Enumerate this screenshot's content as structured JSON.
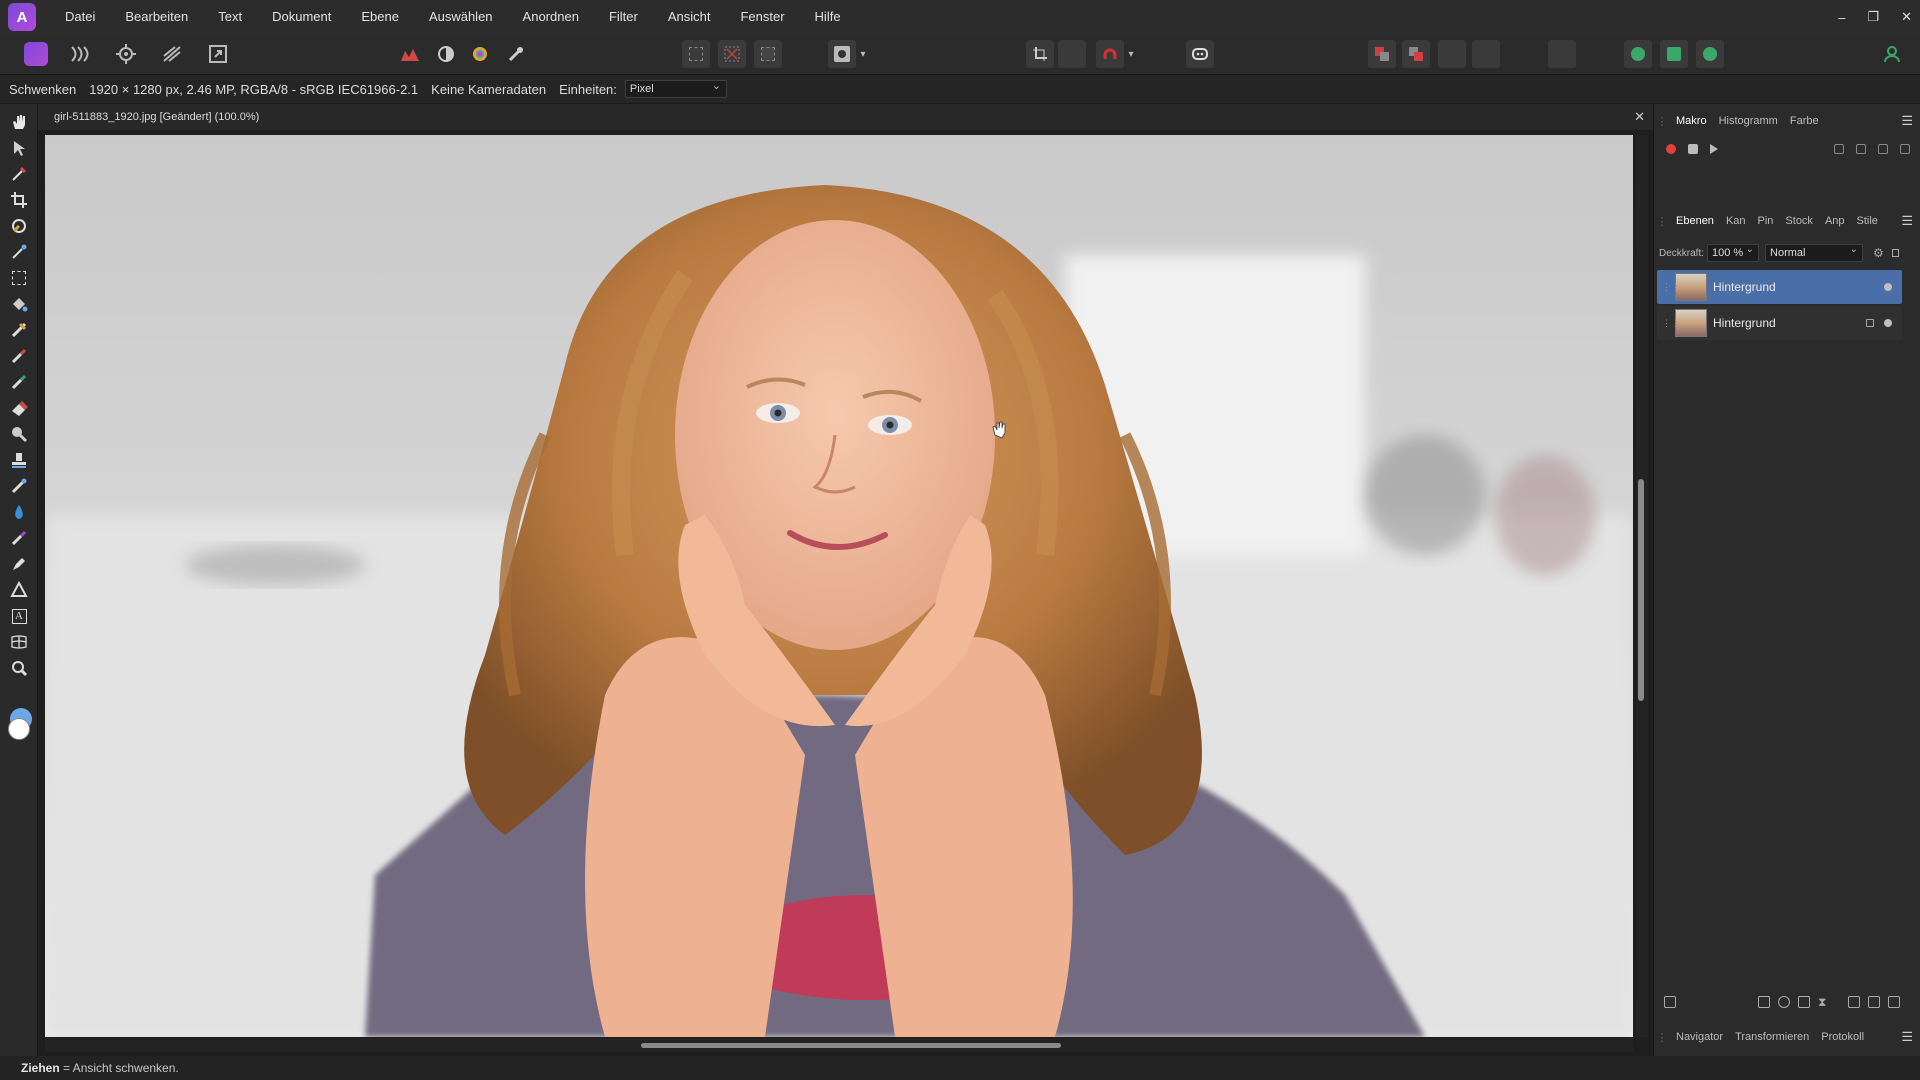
{
  "menu": {
    "items": [
      "Datei",
      "Bearbeiten",
      "Text",
      "Dokument",
      "Ebene",
      "Auswählen",
      "Anordnen",
      "Filter",
      "Ansicht",
      "Fenster",
      "Hilfe"
    ],
    "window_controls": [
      "–",
      "❐",
      "✕"
    ]
  },
  "context": {
    "tool": "Schwenken",
    "image_info": "1920 × 1280 px, 2.46 MP, RGBA/8 - sRGB IEC61966-2.1",
    "camera": "Keine Kameradaten",
    "units_label": "Einheiten:",
    "units_value": "Pixel"
  },
  "document": {
    "tab_title": "girl-511883_1920.jpg [Geändert] (100.0%)",
    "close_glyph": "✕"
  },
  "status": {
    "action": "Ziehen",
    "description": " = Ansicht schwenken."
  },
  "panels": {
    "top_tabs": [
      "Makro",
      "Histogramm",
      "Farbe"
    ],
    "layer_tabs": [
      "Ebenen",
      "Kan",
      "Pin",
      "Stock",
      "Anp",
      "Stile"
    ],
    "opacity_label": "Deckkraft:",
    "opacity_value": "100 %",
    "blend_mode": "Normal",
    "layers": [
      {
        "name": "Hintergrund",
        "selected": true,
        "locked": false
      },
      {
        "name": "Hintergrund",
        "selected": false,
        "locked": true
      }
    ],
    "bottom_tabs": [
      "Navigator",
      "Transformieren",
      "Protokoll"
    ],
    "menu_glyph": "☰"
  },
  "icons": {
    "app_logo": "affinity-photo-logo",
    "tools": [
      "hand-icon",
      "move-icon",
      "color-picker-icon",
      "crop-icon",
      "selection-brush-icon",
      "magic-wand-icon",
      "marquee-icon",
      "flood-fill-icon",
      "gradient-icon",
      "paint-brush-icon",
      "pixel-brush-icon",
      "eraser-icon",
      "dodge-icon",
      "clone-icon",
      "healing-icon",
      "blur-icon",
      "smudge-icon",
      "pen-icon",
      "shape-icon",
      "text-icon",
      "mesh-warp-icon",
      "zoom-icon"
    ]
  },
  "colors": {
    "accent": "#4a6fa8",
    "record": "#e04040",
    "brand": "#8e4fd6"
  }
}
